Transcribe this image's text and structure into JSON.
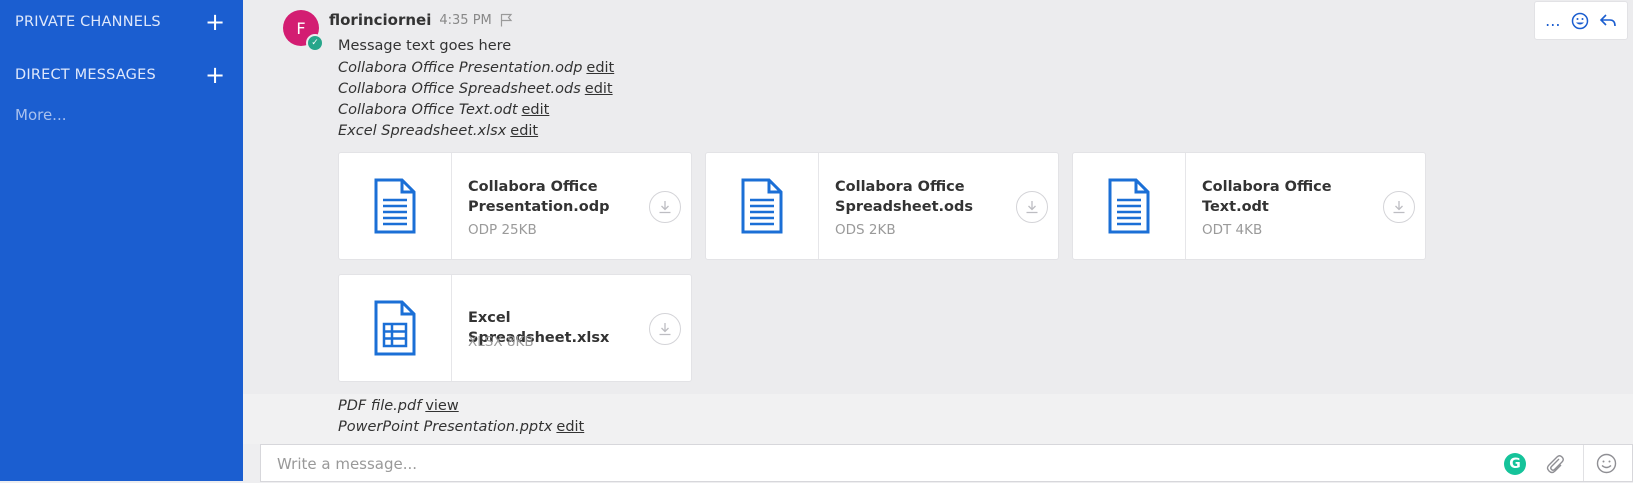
{
  "sidebar": {
    "private_channels": "PRIVATE CHANNELS",
    "direct_messages": "DIRECT MESSAGES",
    "more": "More...",
    "plus": "+"
  },
  "post": {
    "avatar_letter": "F",
    "username": "florinciornei",
    "time": "4:35 PM",
    "message": "Message text goes here",
    "file_links": [
      {
        "name": "Collabora Office Presentation.odp",
        "action": "edit"
      },
      {
        "name": "Collabora Office Spreadsheet.ods",
        "action": "edit"
      },
      {
        "name": "Collabora Office Text.odt",
        "action": "edit"
      },
      {
        "name": "Excel Spreadsheet.xlsx",
        "action": "edit"
      }
    ],
    "attachments": [
      {
        "name_line1": "Collabora Office",
        "name_line2": "Presentation.odp",
        "meta": "ODP 25KB",
        "icon": "document-icon"
      },
      {
        "name_line1": "Collabora Office",
        "name_line2": "Spreadsheet.ods",
        "meta": "ODS 2KB",
        "icon": "document-icon"
      },
      {
        "name_line1": "Collabora Office",
        "name_line2": "Text.odt",
        "meta": "ODT 4KB",
        "icon": "document-icon"
      },
      {
        "name": "Excel Spreadsheet.xlsx",
        "meta": "XLSX 8KB",
        "icon": "spreadsheet-icon"
      }
    ],
    "more_links": [
      {
        "name": "PDF file.pdf",
        "action": "view"
      },
      {
        "name": "PowerPoint Presentation.pptx",
        "action": "edit"
      }
    ]
  },
  "hover_actions": {
    "more": "..."
  },
  "composer": {
    "placeholder": "Write a message...",
    "grammarly": "G"
  },
  "colors": {
    "sidebar": "#1b5ed0",
    "accent": "#1b5ed0",
    "avatar": "#d31d72",
    "status": "#27a68a"
  }
}
